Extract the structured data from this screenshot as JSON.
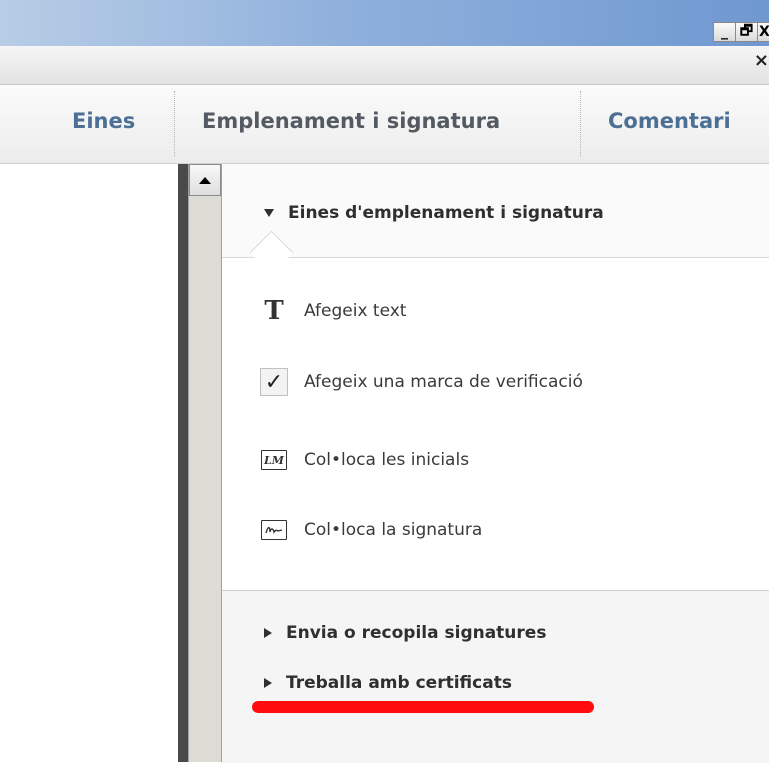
{
  "window": {
    "buttons": [
      {
        "name": "minimize",
        "glyph": "_"
      },
      {
        "name": "restore",
        "glyph": "🗗"
      },
      {
        "name": "close",
        "glyph": "X"
      }
    ],
    "doc_close_glyph": "×"
  },
  "tabs": [
    {
      "label": "Eines"
    },
    {
      "label": "Emplenament i signatura"
    },
    {
      "label": "Comentari"
    }
  ],
  "panel": {
    "section_title": "Eines d'emplenament i signatura",
    "tools": [
      {
        "label": "Afegeix text",
        "icon": "text-T-icon",
        "glyph": "T"
      },
      {
        "label": "Afegeix una marca de verificació",
        "icon": "checkmark-icon",
        "glyph": "✓"
      },
      {
        "label": "Col•loca les inicials",
        "icon": "initials-icon",
        "glyph": "LM"
      },
      {
        "label": "Col•loca la signatura",
        "icon": "signature-icon",
        "glyph": ""
      }
    ],
    "collapsed_sections": [
      {
        "label": "Envia o recopila signatures"
      },
      {
        "label": "Treballa amb certificats"
      }
    ]
  },
  "colors": {
    "tab_text": "#4b6f95",
    "active_tab_text": "#535a62",
    "highlight_mark": "#ff0d0d"
  }
}
